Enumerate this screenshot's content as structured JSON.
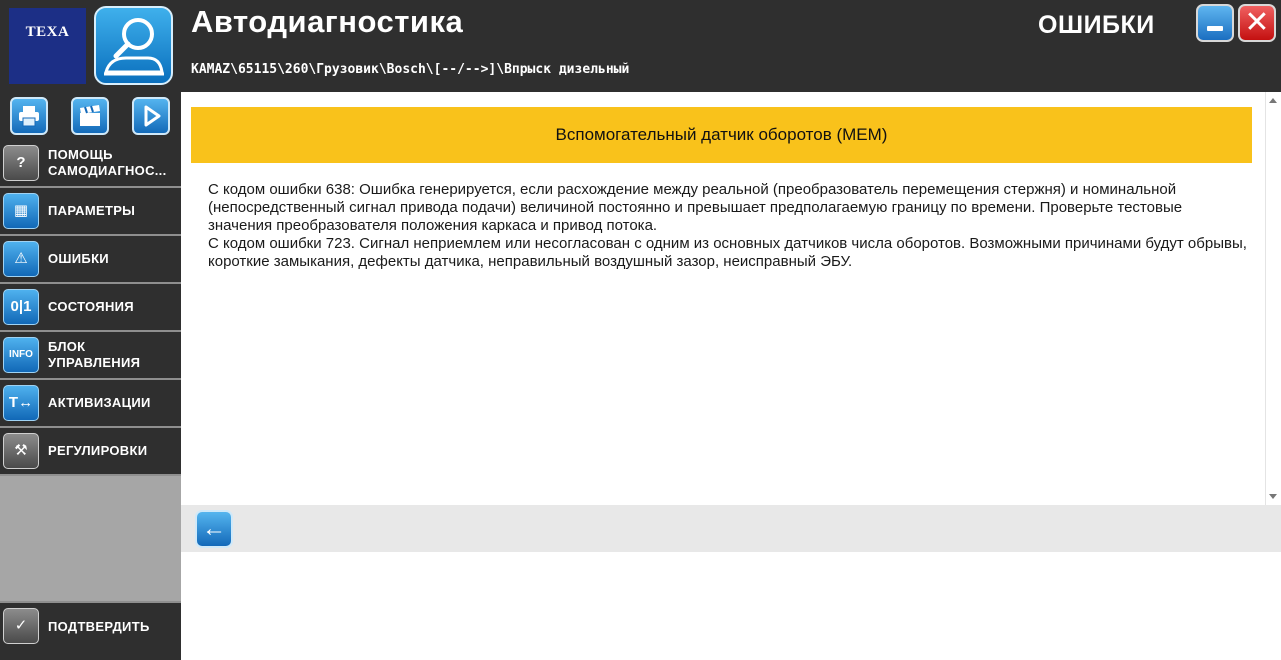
{
  "header": {
    "brand_logo_text": "TEXA",
    "title": "Автодиагностика",
    "breadcrumb": "KAMAZ\\65115\\260\\Грузовик\\Bosch\\[--/-->]\\Впрыск дизельный",
    "section": "ОШИБКИ",
    "minimize_icon": "minimize-icon",
    "close_icon": "close-icon"
  },
  "toolbar": {
    "buttons": [
      {
        "icon": "printer-icon"
      },
      {
        "icon": "clapperboard-icon"
      },
      {
        "icon": "play-icon"
      }
    ]
  },
  "sidebar": {
    "items": [
      {
        "label": "ПОМОЩЬ\nСАМОДИАГНОС...",
        "icon": "help-icon"
      },
      {
        "label": "ПАРАМЕТРЫ",
        "icon": "grid-icon"
      },
      {
        "label": "ОШИБКИ",
        "icon": "warning-icon"
      },
      {
        "label": "СОСТОЯНИЯ",
        "icon": "states-icon"
      },
      {
        "label": "БЛОК\nУПРАВЛЕНИЯ",
        "icon": "info-icon"
      },
      {
        "label": "АКТИВИЗАЦИИ",
        "icon": "activation-icon"
      },
      {
        "label": "РЕГУЛИРОВКИ",
        "icon": "adjust-icon"
      }
    ],
    "confirm_label": "ПОДТВЕРДИТЬ"
  },
  "main": {
    "banner": "Вспомогательный датчик оборотов (MEM)",
    "lines": [
      "С кодом ошибки 638: Ошибка генерируется, если расхождение между реальной (преобразователь перемещения стержня) и номинальной (непосредственный сигнал привода подачи) величиной постоянно и превышает предполагаемую границу по времени. Проверьте тестовые значения преобразователя положения каркаса и привод потока.",
      "С кодом ошибки 723. Сигнал неприемлем или несогласован с одним из основных датчиков числа оборотов. Возможными причинами будут обрывы, короткие замыкания, дефекты датчика, неправильный воздушный зазор, неисправный ЭБУ."
    ]
  },
  "footer": {
    "back_icon": "back-arrow-icon"
  },
  "colors": {
    "header_bg": "#2f2f2f",
    "banner_bg": "#f9c21b",
    "accent_blue": "#1b6fc1",
    "close_red": "#c41010",
    "sidebar_fill": "#a6a6a6"
  }
}
